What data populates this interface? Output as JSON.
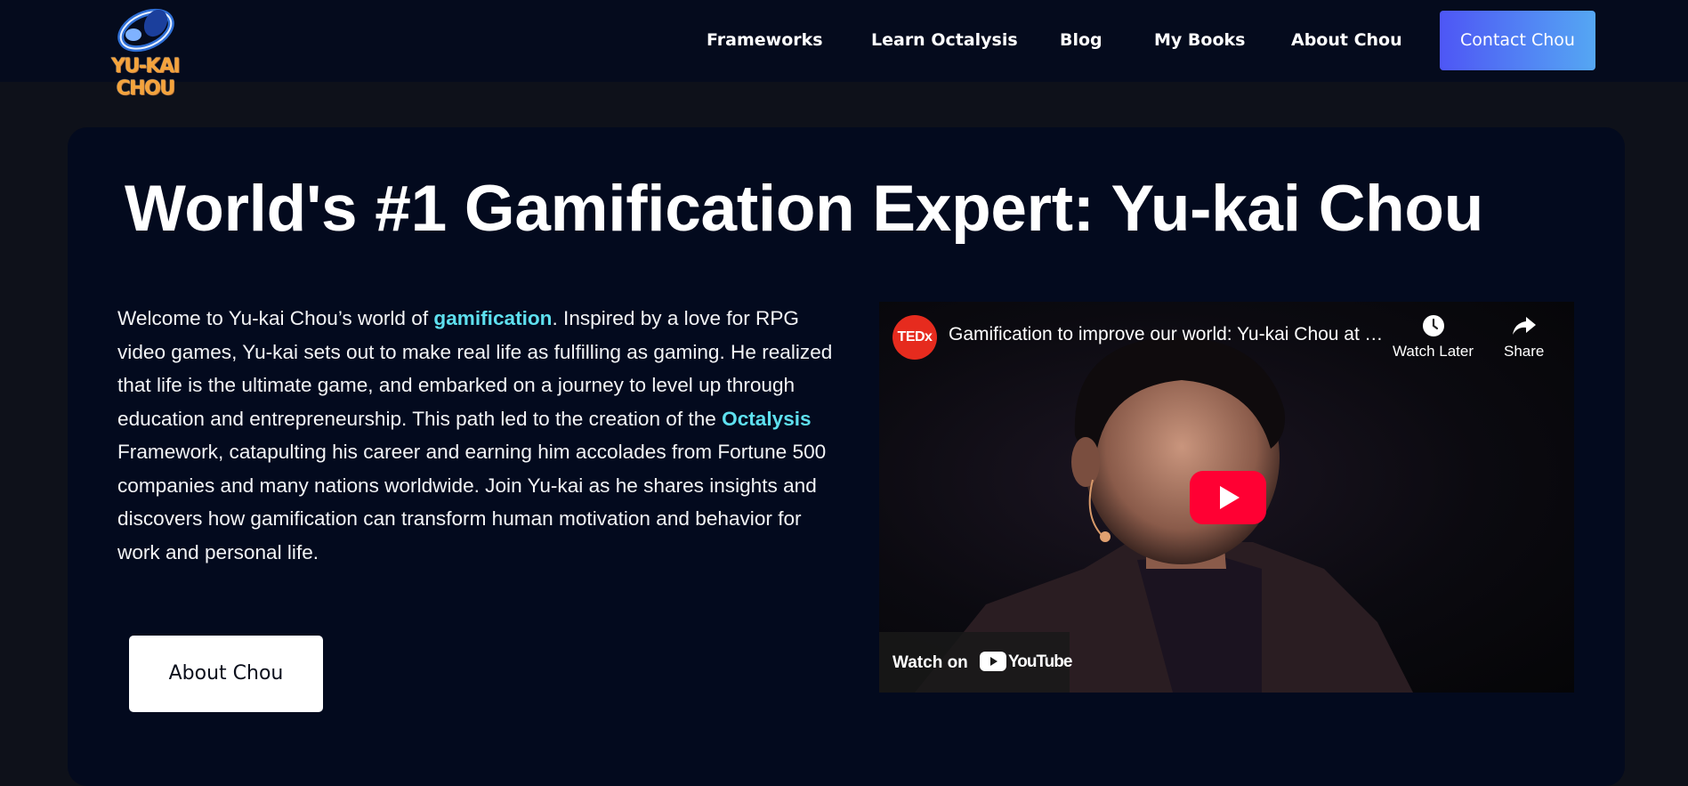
{
  "header": {
    "logo_text": "YU-KAI CHOU",
    "nav": [
      {
        "label": "Frameworks"
      },
      {
        "label": "Learn Octalysis"
      },
      {
        "label": "Blog"
      },
      {
        "label": "My Books"
      },
      {
        "label": "About Chou"
      }
    ],
    "contact_label": "Contact Chou"
  },
  "hero": {
    "title": "World's #1 Gamification Expert: Yu-kai Chou",
    "intro": {
      "part1": "Welcome to Yu-kai Chou’s world of ",
      "link1": "gamification",
      "part2": ". Inspired by a love for RPG video games, Yu-kai sets out to make real life as fulfilling as gaming. He realized that life is the ultimate game, and embarked on a journey to level up through education and entrepreneurship. This path led to the creation of the ",
      "link2": "Octalysis",
      "part3": " Framework, catapulting his career and earning him accolades from Fortune 500 companies and many nations worldwide. Join Yu-kai as he shares insights and discovers how gamification can transform human motivation and behavior for work and personal life."
    },
    "about_button": "About Chou"
  },
  "video": {
    "channel_badge": "TEDx",
    "title": "Gamification to improve our world: Yu-kai Chou at TEDxLausanne",
    "watch_later": "Watch Later",
    "share": "Share",
    "watch_on": "Watch on",
    "youtube": "YouTube"
  },
  "colors": {
    "page_bg": "#0e111a",
    "header_bg": "#050b1d",
    "card_bg": "#030a1e",
    "link_accent": "#5ee0ef",
    "contact_gradient_start": "#4e56f5",
    "contact_gradient_end": "#55a7f3",
    "youtube_red": "#ff0033",
    "ted_red": "#e62b1e"
  }
}
